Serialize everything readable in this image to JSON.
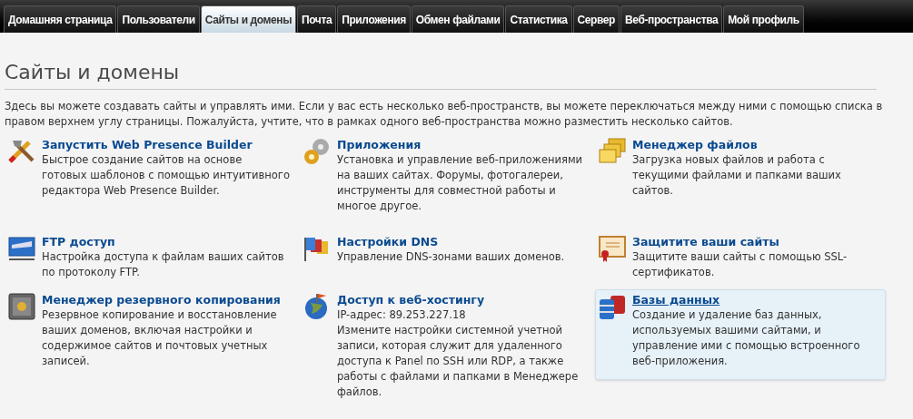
{
  "tabs": [
    {
      "label": "Домашняя страница",
      "selected": false
    },
    {
      "label": "Пользователи",
      "selected": false
    },
    {
      "label": "Сайты и домены",
      "selected": true
    },
    {
      "label": "Почта",
      "selected": false
    },
    {
      "label": "Приложения",
      "selected": false
    },
    {
      "label": "Обмен файлами",
      "selected": false
    },
    {
      "label": "Статистика",
      "selected": false
    },
    {
      "label": "Сервер",
      "selected": false
    },
    {
      "label": "Веб-пространства",
      "selected": false
    },
    {
      "label": "Мой профиль",
      "selected": false
    }
  ],
  "page": {
    "title": "Сайты и домены",
    "intro": "Здесь вы можете создавать сайты и управлять ими. Если у вас есть несколько веб-пространств, вы можете переключаться между ними с помощью списка в правом верхнем углу страницы. Пожалуйста, учтите, что в рамках одного веб-пространства можно разместить несколько сайтов."
  },
  "tiles": [
    {
      "title": "Запустить Web Presence Builder",
      "lines": [
        "Быстрое создание сайтов на основе готовых шаблонов с помощью интуитивного редактора Web Presence Builder."
      ],
      "highlighted": false
    },
    {
      "title": "Приложения",
      "lines": [
        "Установка и управление веб-приложениями на ваших сайтах. Форумы, фотогалереи, инструменты для совместной работы и многое другое."
      ],
      "highlighted": false
    },
    {
      "title": "Менеджер файлов",
      "lines": [
        "Загрузка новых файлов и работа с текущими файлами и папками ваших сайтов."
      ],
      "highlighted": false
    },
    {
      "title": "FTP доступ",
      "lines": [
        "Настройка доступа к файлам ваших сайтов по протоколу FTP."
      ],
      "highlighted": false
    },
    {
      "title": "Настройки DNS",
      "lines": [
        "Управление DNS-зонами ваших доменов."
      ],
      "highlighted": false
    },
    {
      "title": "Защитите ваши сайты",
      "lines": [
        "Защитите ваши сайты с помощью SSL-сертификатов."
      ],
      "highlighted": false
    },
    {
      "title": "Менеджер резервного копирования",
      "lines": [
        "Резервное копирование и восстановление ваших доменов, включая настройки и содержимое сайтов и почтовых учетных записей."
      ],
      "highlighted": false
    },
    {
      "title": "Доступ к веб-хостингу",
      "lines": [
        "IP-адрес: 89.253.227.18",
        "Измените настройки системной учетной записи, которая служит для удаленного доступа к Panel по SSH или RDP, а также работы с файлами и папками в Менеджере файлов."
      ],
      "highlighted": false
    },
    {
      "title": "Базы данных",
      "lines": [
        "Создание и удаление баз данных, используемых вашими сайтами, и управление ими с помощью встроенного веб-приложения."
      ],
      "highlighted": true
    }
  ]
}
